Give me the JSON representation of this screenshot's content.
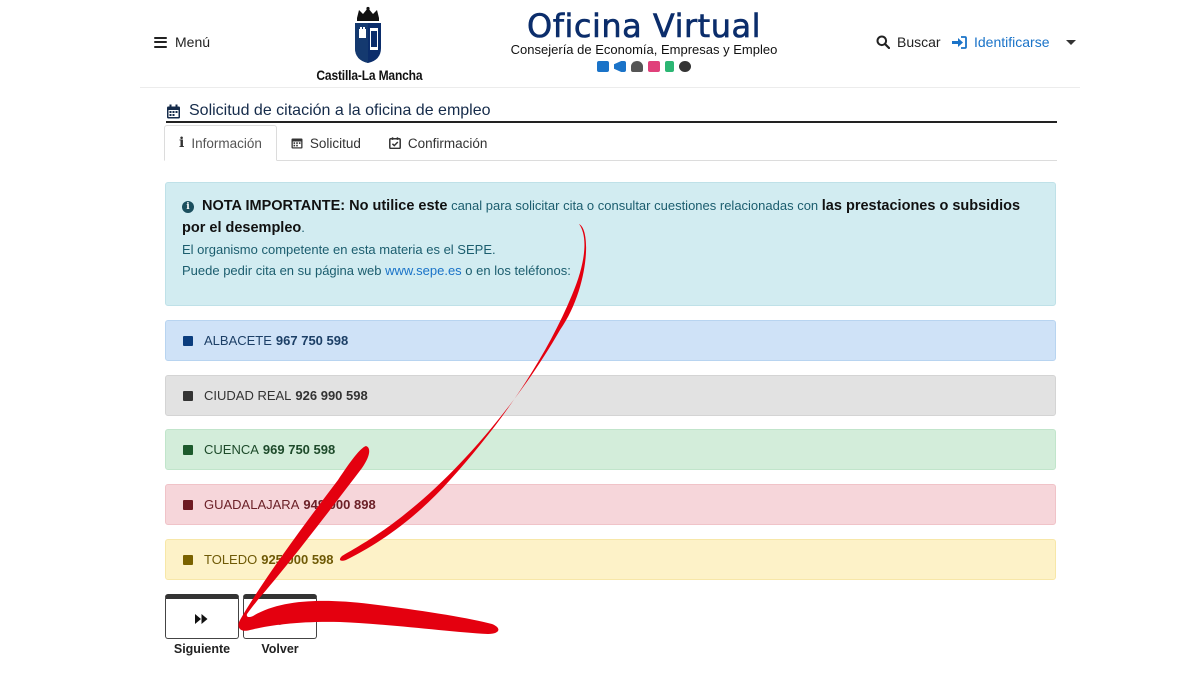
{
  "header": {
    "menu_label": "Menú",
    "logo_text": "Castilla-La Mancha",
    "brand_title": "Oficina Virtual",
    "brand_subtitle": "Consejería de Economía, Empresas y Empleo",
    "brand_icons": [
      {
        "icon": "id-card-icon",
        "color": "#1a73c8"
      },
      {
        "icon": "megaphone-icon",
        "color": "#1a73c8"
      },
      {
        "icon": "user-graduate-icon",
        "color": "#555555"
      },
      {
        "icon": "list-icon",
        "color": "#e0407a"
      },
      {
        "icon": "clipboard-icon",
        "color": "#2bb673"
      },
      {
        "icon": "cogs-icon",
        "color": "#333333"
      }
    ],
    "search_label": "Buscar",
    "login_label": "Identificarse"
  },
  "page": {
    "title": "Solicitud de citación a la oficina de empleo",
    "tabs": [
      {
        "label": "Información",
        "icon": "info-icon",
        "active": true
      },
      {
        "label": "Solicitud",
        "icon": "calendar-icon",
        "active": false
      },
      {
        "label": "Confirmación",
        "icon": "calendar-check-icon",
        "active": false
      }
    ]
  },
  "notice": {
    "lead_bold": "NOTA IMPORTANTE: No utilice este",
    "lead_normal": " canal para solicitar cita o consultar cuestiones relacionadas con ",
    "lead_bold2": "las prestaciones o subsidios por el desempleo",
    "lead_end": ".",
    "line2": "El organismo competente en esta materia es el SEPE.",
    "line3_prefix": "Puede pedir cita en su página web ",
    "line3_link": "www.sepe.es",
    "line3_suffix": " o en los teléfonos:"
  },
  "provinces": [
    {
      "name": "ALBACETE",
      "phone": "967 750 598",
      "bg": "#cfe2f7",
      "border": "#b8d4f0",
      "square": "#0b3d7e",
      "text": "#1c3f66"
    },
    {
      "name": "CIUDAD REAL",
      "phone": "926 990 598",
      "bg": "#e2e2e2",
      "border": "#d4d4d4",
      "square": "#333333",
      "text": "#333333"
    },
    {
      "name": "CUENCA",
      "phone": "969 750 598",
      "bg": "#d3edda",
      "border": "#c1e5cb",
      "square": "#1d5a2c",
      "text": "#1d4a2a"
    },
    {
      "name": "GUADALAJARA",
      "phone": "949 000 898",
      "bg": "#f6d6da",
      "border": "#f0c3c8",
      "square": "#6e1a22",
      "text": "#6b2027"
    },
    {
      "name": "TOLEDO",
      "phone": "925 000 598",
      "bg": "#fdf2c8",
      "border": "#f7e7a8",
      "square": "#7a6200",
      "text": "#6f5a06"
    }
  ],
  "buttons": {
    "next_label": "Siguiente",
    "back_label": "Volver"
  }
}
